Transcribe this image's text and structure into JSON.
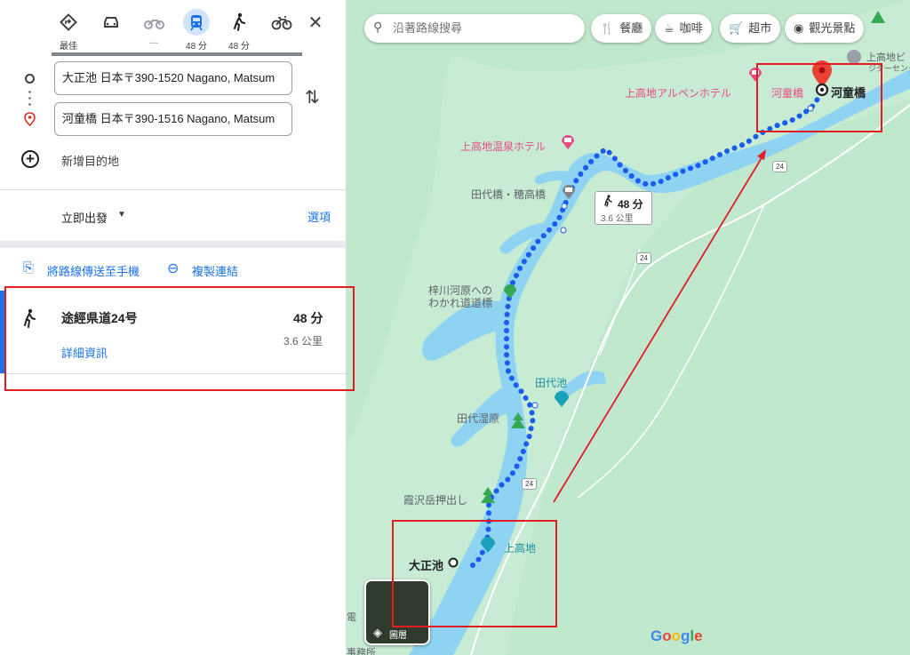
{
  "travel_modes": [
    {
      "name": "best",
      "icon": "diamond-turn-icon",
      "label": "最佳"
    },
    {
      "name": "drive",
      "icon": "car-icon",
      "label": ""
    },
    {
      "name": "motorcycle",
      "icon": "motorcycle-icon",
      "label": "—"
    },
    {
      "name": "transit",
      "icon": "train-icon",
      "label": "48 分"
    },
    {
      "name": "walk",
      "icon": "walking-icon",
      "label": "48 分"
    },
    {
      "name": "bicycle",
      "icon": "bicycle-icon",
      "label": ""
    }
  ],
  "origin": {
    "value": "大正池 日本〒390-1520 Nagano, Matsum"
  },
  "destination": {
    "value": "河童橋 日本〒390-1516 Nagano, Matsum"
  },
  "add_destination": "新增目的地",
  "depart": {
    "label": "立即出發",
    "options": "選項"
  },
  "share": {
    "send_label": "將路線傳送至手機",
    "copy_label": "複製連結"
  },
  "route": {
    "name": "途經県道24号",
    "time": "48 分",
    "distance": "3.6 公里",
    "details": "詳細資訊"
  },
  "map": {
    "search_placeholder": "沿著路線搜尋",
    "chips": [
      "餐廳",
      "咖啡",
      "超市",
      "觀光景點"
    ],
    "labels": {
      "kamikochi_alpen_hotel": "上高地アルペンホテル",
      "kappa_bashi_pink": "河童橋",
      "kappa_bashi_dest": "河童橋",
      "onsen_hotel": "上高地温泉ホテル",
      "tashiro_bashi": "田代橋・穂高橋",
      "azusagawa": "梓川河原への",
      "azusagawa2": "わかれ道道標",
      "tashiro_ike": "田代池",
      "tashiro_shitsugen": "田代湿原",
      "kasumisawa": "霞沢岳押出し",
      "kamikochi": "上高地",
      "taisho_ike": "大正池",
      "kamikochi_top": "上高地ビ",
      "kamikochi_top2": "ジターセンター",
      "bottom_a": "電",
      "bottom_b": "事務所"
    },
    "route_tip": {
      "time": "48 分",
      "distance": "3.6 公里"
    },
    "road_number": "24",
    "layers_label": "圖層",
    "google_logo": "Google"
  }
}
